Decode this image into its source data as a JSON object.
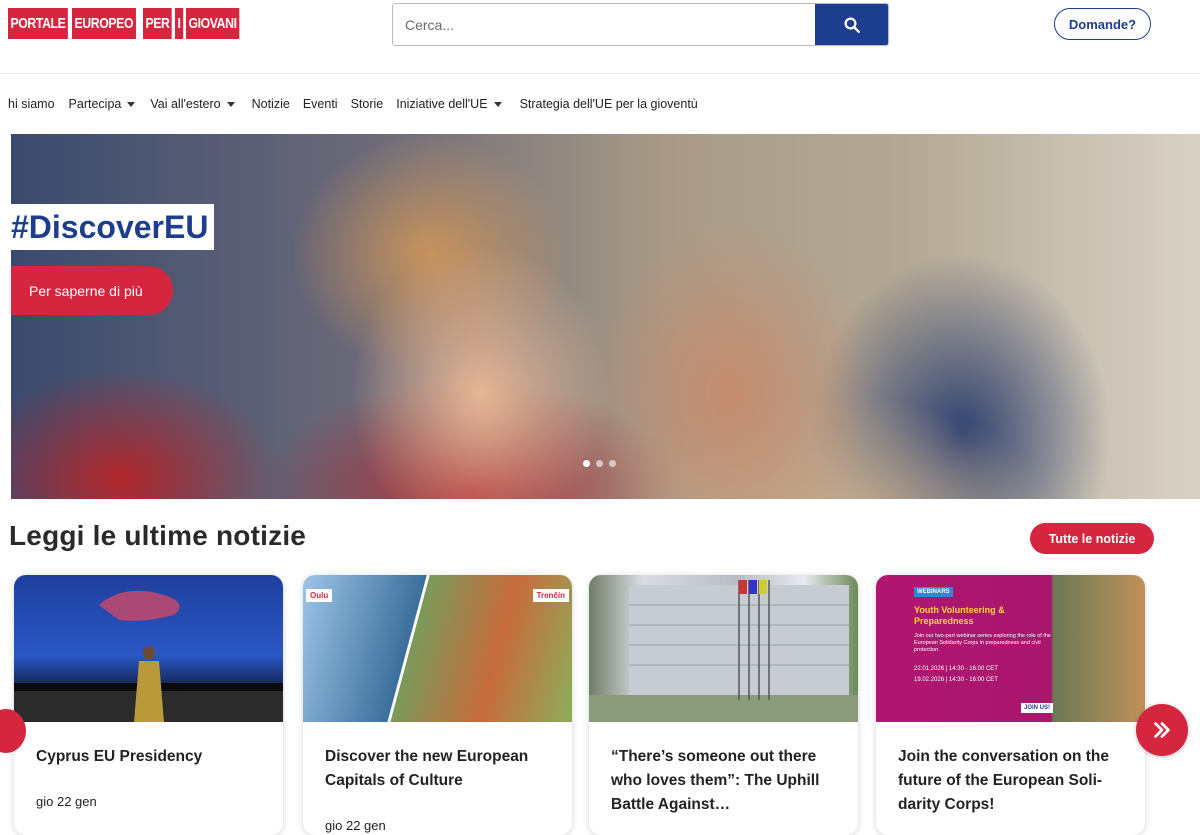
{
  "logo": {
    "words": [
      "PORTALE",
      "EUROPEO",
      "PER",
      "I",
      "GIOVANI"
    ]
  },
  "search": {
    "placeholder": "Cerca...",
    "icon": "search-icon"
  },
  "header": {
    "help_label": "Domande?"
  },
  "nav": {
    "items": [
      {
        "label": "hi siamo",
        "dropdown": false
      },
      {
        "label": "Partecipa",
        "dropdown": true
      },
      {
        "label": "Vai all'estero",
        "dropdown": true
      },
      {
        "label": "Notizie",
        "dropdown": false
      },
      {
        "label": "Eventi",
        "dropdown": false
      },
      {
        "label": "Storie",
        "dropdown": false
      },
      {
        "label": "Iniziative dell'UE",
        "dropdown": true
      },
      {
        "label": "Strategia dell'UE per la gioventù",
        "dropdown": false
      }
    ]
  },
  "hero": {
    "title": "#DiscoverEU",
    "button_label": "Per saperne di più",
    "slides": 3,
    "active_slide": 1
  },
  "news": {
    "heading": "Leggi le ultime notizie",
    "all_label": "Tutte le notizie",
    "cards": [
      {
        "title": "Cyprus EU Presidency",
        "date": "gio 22 gen"
      },
      {
        "title": "Discover the new European Capitals of Culture",
        "date": "gio 22 gen",
        "image_tags": [
          "Oulu",
          "Trenčín"
        ]
      },
      {
        "title": "“There’s someone out there who loves them”: The Uphill Battle Against…",
        "date": ""
      },
      {
        "title": "Join the conversation on the future of the European Soli-darity Corps!",
        "date": "",
        "image_text": {
          "badge": "WEBINARS",
          "heading": "Youth Volunteering & Preparedness",
          "body": "Join our two-part webinar series exploring the role of the European Solidarity Corps in preparedness and civil protection.",
          "date1": "22.01.2026 | 14:30 - 16:00 CET",
          "date2": "19.02.2026 | 14:30 - 16:00 CET",
          "cta": "JOIN US!"
        }
      }
    ]
  },
  "colors": {
    "brand_red": "#d6263f",
    "brand_blue": "#1d3d8f"
  },
  "carousel": {
    "next_icon": "chevron-double-right-icon",
    "prev_icon": "chevron-left-icon"
  }
}
